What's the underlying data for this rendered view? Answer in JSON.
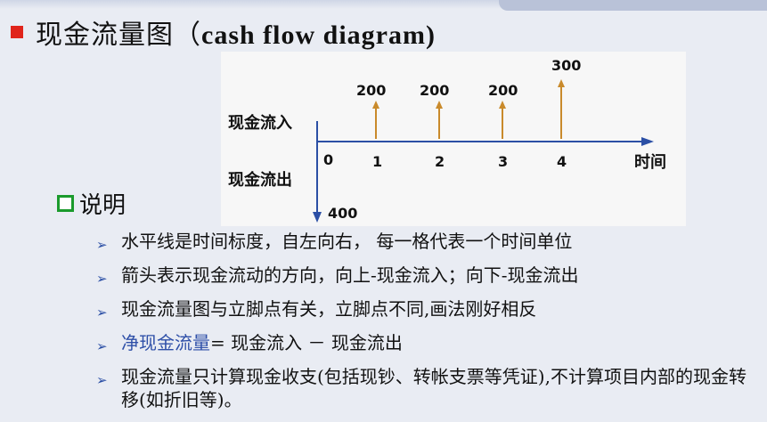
{
  "title": {
    "chinese": "现金流量图（",
    "english": "cash flow diagram)"
  },
  "diagram": {
    "inflow_label": "现金流入",
    "outflow_label": "现金流出",
    "time_label": "时间",
    "time_points": [
      "0",
      "1",
      "2",
      "3",
      "4"
    ],
    "inflows": [
      {
        "period": "1",
        "amount": "200"
      },
      {
        "period": "2",
        "amount": "200"
      },
      {
        "period": "3",
        "amount": "200"
      },
      {
        "period": "4",
        "amount": "300"
      }
    ],
    "outflow": {
      "period": "0",
      "amount": "400"
    }
  },
  "section": {
    "label": "说明"
  },
  "notes": [
    {
      "text": "水平线是时间标度，自左向右， 每一格代表一个时间单位"
    },
    {
      "text": "箭头表示现金流动的方向，向上-现金流入；向下-现金流出"
    },
    {
      "text": "现金流量图与立脚点有关，立脚点不同,画法刚好相反"
    },
    {
      "term": "净现金流量",
      "text": "= 现金流入 － 现金流出"
    },
    {
      "text": "现金流量只计算现金收支(包括现钞、转帐支票等凭证),不计算项目内部的现金转移(如折旧等)。"
    }
  ],
  "colors": {
    "title_bullet": "#e0241b",
    "section_bullet": "#1a9a2c",
    "arrow_bullet": "#2b4fa5",
    "inflow_arrow": "#c98a2b",
    "outflow_arrow": "#2b4fa5",
    "term_highlight": "#2e4fa8"
  }
}
